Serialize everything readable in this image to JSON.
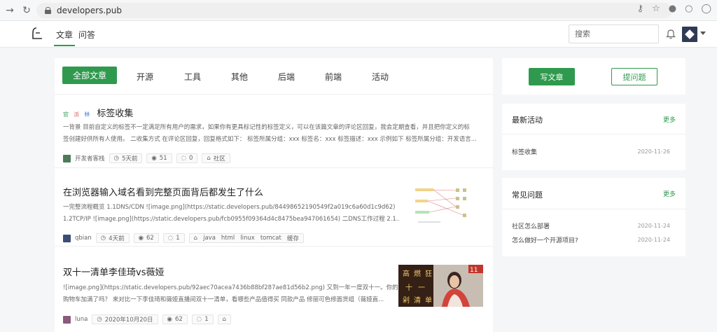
{
  "browser": {
    "url": "developers.pub"
  },
  "header": {
    "nav": [
      "文章",
      "问答"
    ],
    "search_placeholder": "搜索"
  },
  "tabs": [
    "全部文章",
    "开源",
    "工具",
    "其他",
    "后端",
    "前端",
    "活动"
  ],
  "articles": [
    {
      "title": "标签收集",
      "title_prefix": [
        "官",
        "派",
        "林"
      ],
      "excerpt_lines": [
        "一背景 目前自定义的标签不一定满足所有用户的需求，如果你有更具标记性的标签定义，可以在该篇文章的评论区回复，我会定期查看，并且把你定义的标",
        "签创建好供所有人使用。 二收集方式 在评论区回复，回复格式如下： 标签所属分组：xxx 标签名：xxx 标签描述：xxx 示例如下 标签所属分组：开发语言..."
      ],
      "author": "开发者客栈",
      "time": "5天前",
      "views": "51",
      "comments": "0",
      "tags": [
        "社区"
      ]
    },
    {
      "title": "在浏览器输入域名看到完整页面背后都发生了什么",
      "excerpt_lines": [
        "一完整流程概览 1.1DNS/CDN ![image.png](https://static.developers.pub/84498652190549f2a019c6a60d1c9d62)",
        "1.2TCP/IP ![image.png](https://static.developers.pub/fcb0955f09364d4c8475bea947061654) 二DNS工作过程 2.1..."
      ],
      "author": "qbian",
      "time": "4天前",
      "views": "62",
      "comments": "1",
      "tags": [
        "java",
        "html",
        "linux",
        "tomcat",
        "缓存"
      ]
    },
    {
      "title": "双十一清单李佳琦vs薇娅",
      "excerpt_lines": [
        "![image.png](https://static.developers.pub/92aec70acea7436b88bf287ae81d56b2.png) 又到一年一度双十一。你的",
        "购物车加满了吗？ 来对比一下李佳琦和薇娅直播间双十一清单，看哪些产品值得买 同款产品 修丽可色修面货组（薇娅直..."
      ],
      "author": "luna",
      "time": "2020年10月20日",
      "views": "62",
      "comments": "1",
      "tags": []
    }
  ],
  "sidebar": {
    "write_label": "写文章",
    "ask_label": "提问题",
    "activity": {
      "title": "最新活动",
      "more": "更多",
      "items": [
        {
          "label": "标签收集",
          "date": "2020-11-26"
        }
      ]
    },
    "faq": {
      "title": "常见问题",
      "more": "更多",
      "items": [
        {
          "label": "社区怎么部署",
          "date": "2020-11-24"
        },
        {
          "label": "怎么做好一个开源项目?",
          "date": "2020-11-24"
        }
      ]
    }
  },
  "colors": {
    "accent": "#2f9a4e",
    "page_bg": "#f5f6f7"
  }
}
